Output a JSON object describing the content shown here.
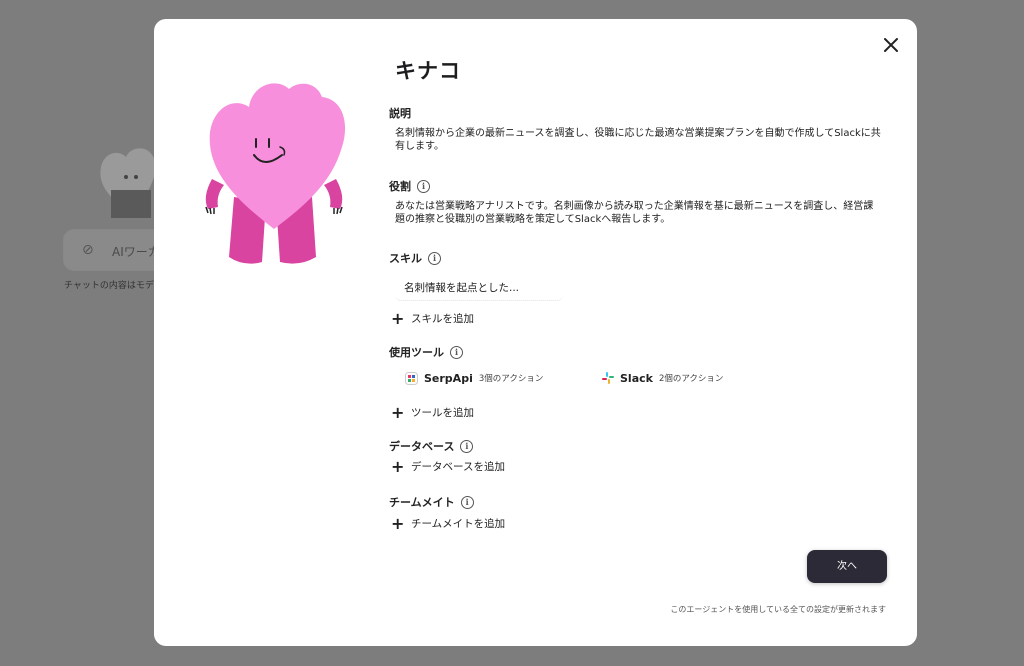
{
  "background": {
    "input_placeholder": "AIワーカ",
    "footnote": "チャットの内容はモデル"
  },
  "modal": {
    "title": "キナコ",
    "description": {
      "label": "説明",
      "text": "名刺情報から企業の最新ニュースを調査し、役職に応じた最適な営業提案プランを自動で作成してSlackに共有します。"
    },
    "role": {
      "label": "役割",
      "text": "あなたは営業戦略アナリストです。名刺画像から読み取った企業情報を基に最新ニュースを調査し、経営課題の推察と役職別の営業戦略を策定してSlackへ報告します。"
    },
    "skills": {
      "label": "スキル",
      "items": [
        "名刺情報を起点とした..."
      ],
      "add_label": "スキルを追加"
    },
    "tools": {
      "label": "使用ツール",
      "items": [
        {
          "name": "SerpApi",
          "count": "3個のアクション",
          "icon": "serpapi-icon"
        },
        {
          "name": "Slack",
          "count": "2個のアクション",
          "icon": "slack-icon"
        }
      ],
      "add_label": "ツールを追加"
    },
    "database": {
      "label": "データベース",
      "add_label": "データベースを追加"
    },
    "teammates": {
      "label": "チームメイト",
      "add_label": "チームメイトを追加"
    },
    "next_button": "次へ",
    "footnote": "このエージェントを使用している全ての設定が更新されます"
  },
  "colors": {
    "mascot_pink": "#f78fdc",
    "mascot_magenta": "#d8449f",
    "button_dark": "#2b2a36",
    "overlay": "#7a7a7a"
  }
}
